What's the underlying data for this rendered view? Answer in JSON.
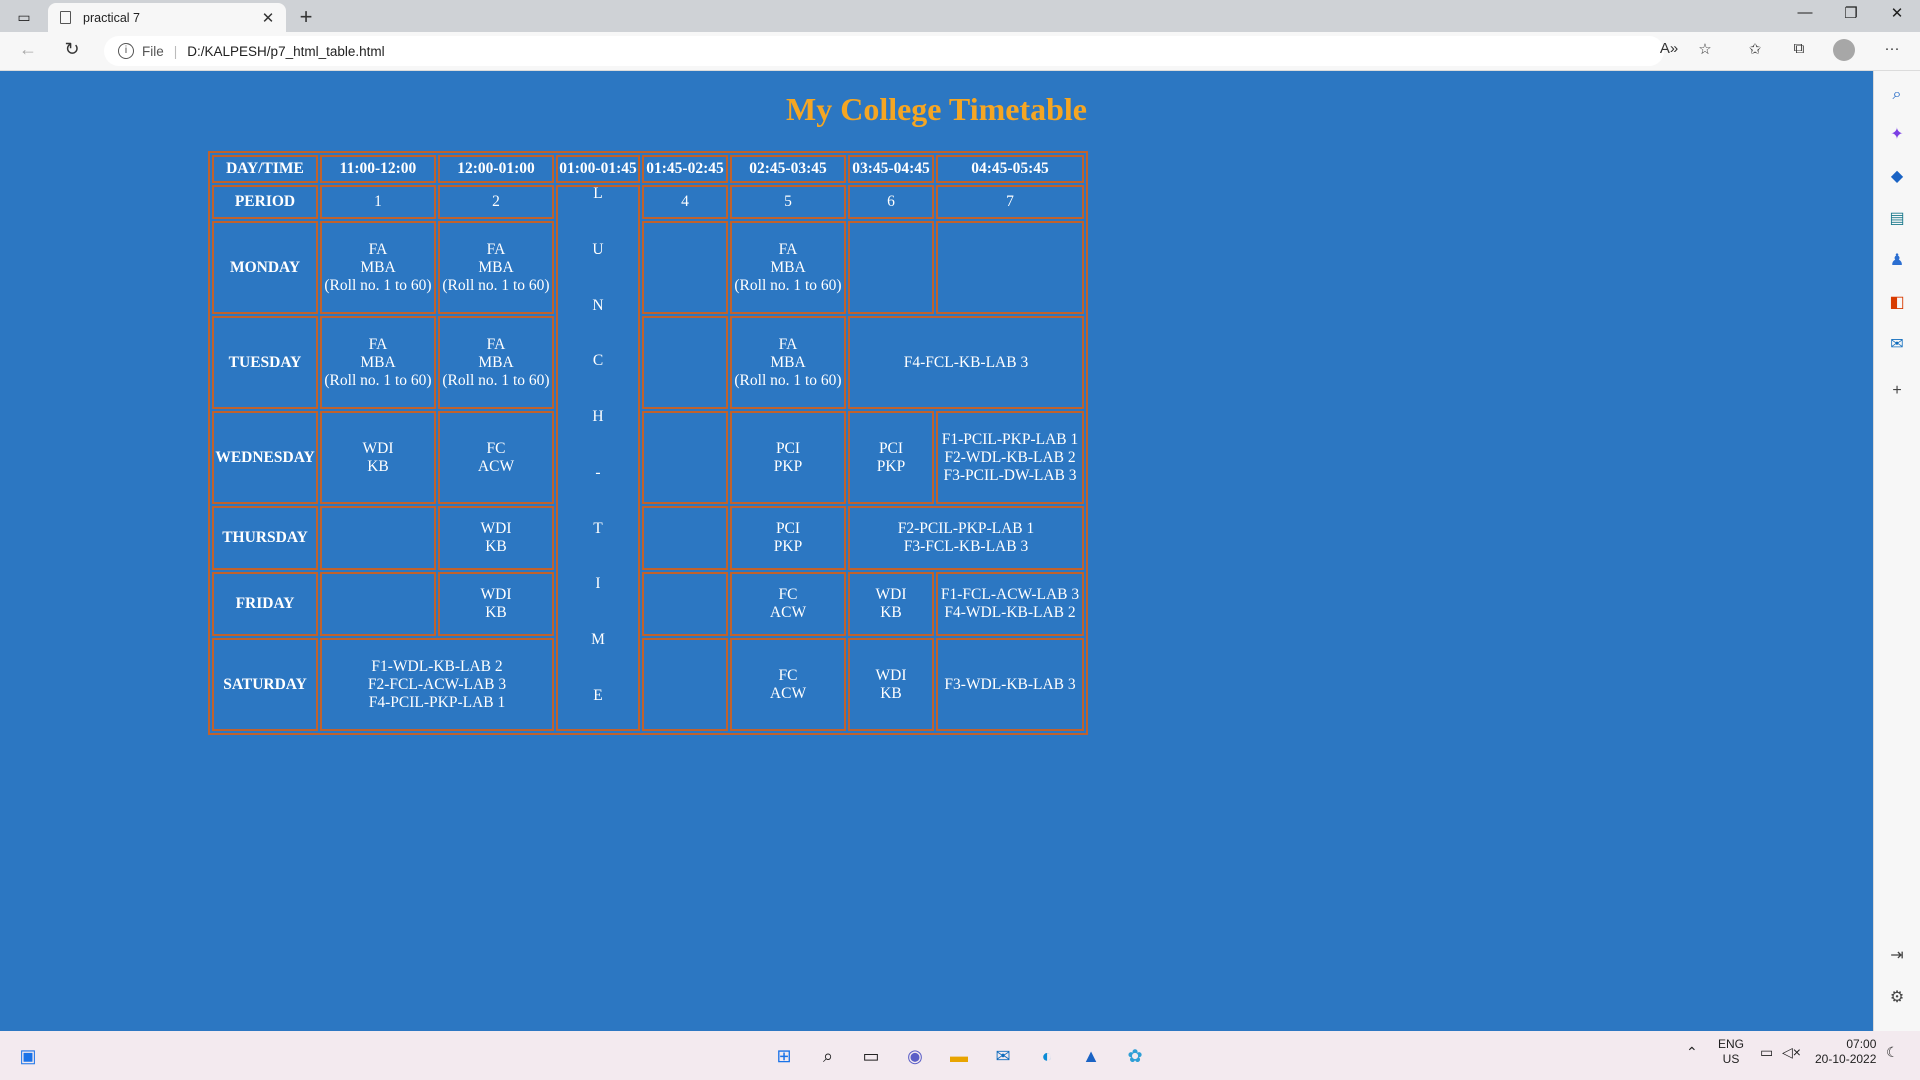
{
  "browser": {
    "tab_title": "practical 7",
    "tab_close": "✕",
    "new_tab": "+",
    "address_scheme": "File",
    "address_url": "D:/KALPESH/p7_html_table.html",
    "window_controls": [
      "—",
      "❐",
      "✕"
    ]
  },
  "page": {
    "title": "My College Timetable",
    "colors": {
      "background": "#2c77c2",
      "title": "#f5a623",
      "border": "#c0622d",
      "text": "#ffffff"
    }
  },
  "timetable": {
    "header": {
      "day_time": "DAY/TIME",
      "times": [
        "11:00-12:00",
        "12:00-01:00",
        "01:00-01:45",
        "01:45-02:45",
        "02:45-03:45",
        "03:45-04:45",
        "04:45-05:45"
      ]
    },
    "period_row": {
      "label": "PERIOD",
      "periods": [
        "1",
        "2",
        "4",
        "5",
        "6",
        "7"
      ]
    },
    "lunch_letters": [
      "L",
      "U",
      "N",
      "C",
      "H",
      "-",
      "T",
      "I",
      "M",
      "E"
    ],
    "monday": {
      "day": "MONDAY",
      "p1": [
        "FA",
        "MBA",
        "(Roll no. 1 to 60)"
      ],
      "p2": [
        "FA",
        "MBA",
        "(Roll no. 1 to 60)"
      ],
      "p5": [
        "FA",
        "MBA",
        "(Roll no. 1 to 60)"
      ]
    },
    "tuesday": {
      "day": "TUESDAY",
      "p1": [
        "FA",
        "MBA",
        "(Roll no. 1 to 60)"
      ],
      "p2": [
        "FA",
        "MBA",
        "(Roll no. 1 to 60)"
      ],
      "p5": [
        "FA",
        "MBA",
        "(Roll no. 1 to 60)"
      ],
      "p6_7": "F4-FCL-KB-LAB 3"
    },
    "wednesday": {
      "day": "WEDNESDAY",
      "p1": [
        "WDI",
        "KB"
      ],
      "p2": [
        "FC",
        "ACW"
      ],
      "p5": [
        "PCI",
        "PKP"
      ],
      "p6": [
        "PCI",
        "PKP"
      ],
      "p7": [
        "F1-PCIL-PKP-LAB 1",
        "F2-WDL-KB-LAB 2",
        "F3-PCIL-DW-LAB 3"
      ]
    },
    "thursday": {
      "day": "THURSDAY",
      "p2": [
        "WDI",
        "KB"
      ],
      "p5": [
        "PCI",
        "PKP"
      ],
      "p6_7": [
        "F2-PCIL-PKP-LAB 1",
        "F3-FCL-KB-LAB 3"
      ]
    },
    "friday": {
      "day": "FRIDAY",
      "p2": [
        "WDI",
        "KB"
      ],
      "p5": [
        "FC",
        "ACW"
      ],
      "p6": [
        "WDI",
        "KB"
      ],
      "p7": [
        "F1-FCL-ACW-LAB 3",
        "F4-WDL-KB-LAB 2"
      ]
    },
    "saturday": {
      "day": "SATURDAY",
      "p1_2": [
        "F1-WDL-KB-LAB 2",
        "F2-FCL-ACW-LAB 3",
        "F4-PCIL-PKP-LAB 1"
      ],
      "p5": [
        "FC",
        "ACW"
      ],
      "p6": [
        "WDI",
        "KB"
      ],
      "p7": "F3-WDL-KB-LAB 3"
    }
  },
  "taskbar": {
    "lang_top": "ENG",
    "lang_bottom": "US",
    "time": "07:00",
    "date": "20-10-2022",
    "icons": [
      "start-icon",
      "search-icon",
      "task-view-icon",
      "chat-icon",
      "file-explorer-icon",
      "mail-icon",
      "edge-icon",
      "photos-icon",
      "app-icon"
    ]
  }
}
